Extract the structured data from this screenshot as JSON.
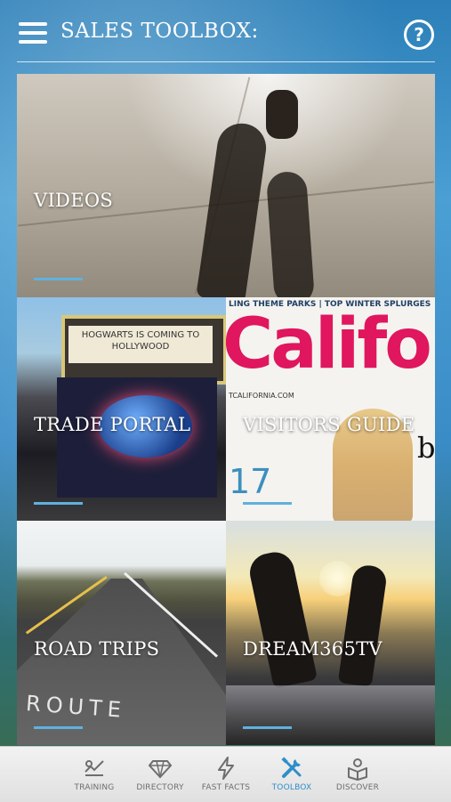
{
  "header": {
    "title": "SALES TOOLBOX:",
    "help_glyph": "?"
  },
  "tiles": [
    {
      "label": "VIDEOS"
    },
    {
      "label": "TRADE PORTAL",
      "marquee_text": "HOGWARTS IS COMING TO HOLLYWOOD"
    },
    {
      "label": "VISITORS GUIDE",
      "cover_topbar": "LING THEME PARKS  |  TOP WINTER SPLURGES",
      "cover_title": "Califor",
      "cover_url": "TCALIFORNIA.COM",
      "cover_number": "17",
      "cover_letter": "b"
    },
    {
      "label": "ROAD TRIPS",
      "road_text": "ROUTE"
    },
    {
      "label": "DREAM365TV"
    }
  ],
  "tabbar": {
    "items": [
      {
        "label": "TRAINING",
        "icon": "training-icon",
        "active": false
      },
      {
        "label": "DIRECTORY",
        "icon": "diamond-icon",
        "active": false
      },
      {
        "label": "FAST FACTS",
        "icon": "lightning-icon",
        "active": false
      },
      {
        "label": "TOOLBOX",
        "icon": "tools-icon",
        "active": true
      },
      {
        "label": "DISCOVER",
        "icon": "discover-icon",
        "active": false
      }
    ]
  },
  "colors": {
    "accent": "#2f8fc8",
    "underline": "#5fb1e0",
    "tab_inactive": "#6e6e6e"
  }
}
